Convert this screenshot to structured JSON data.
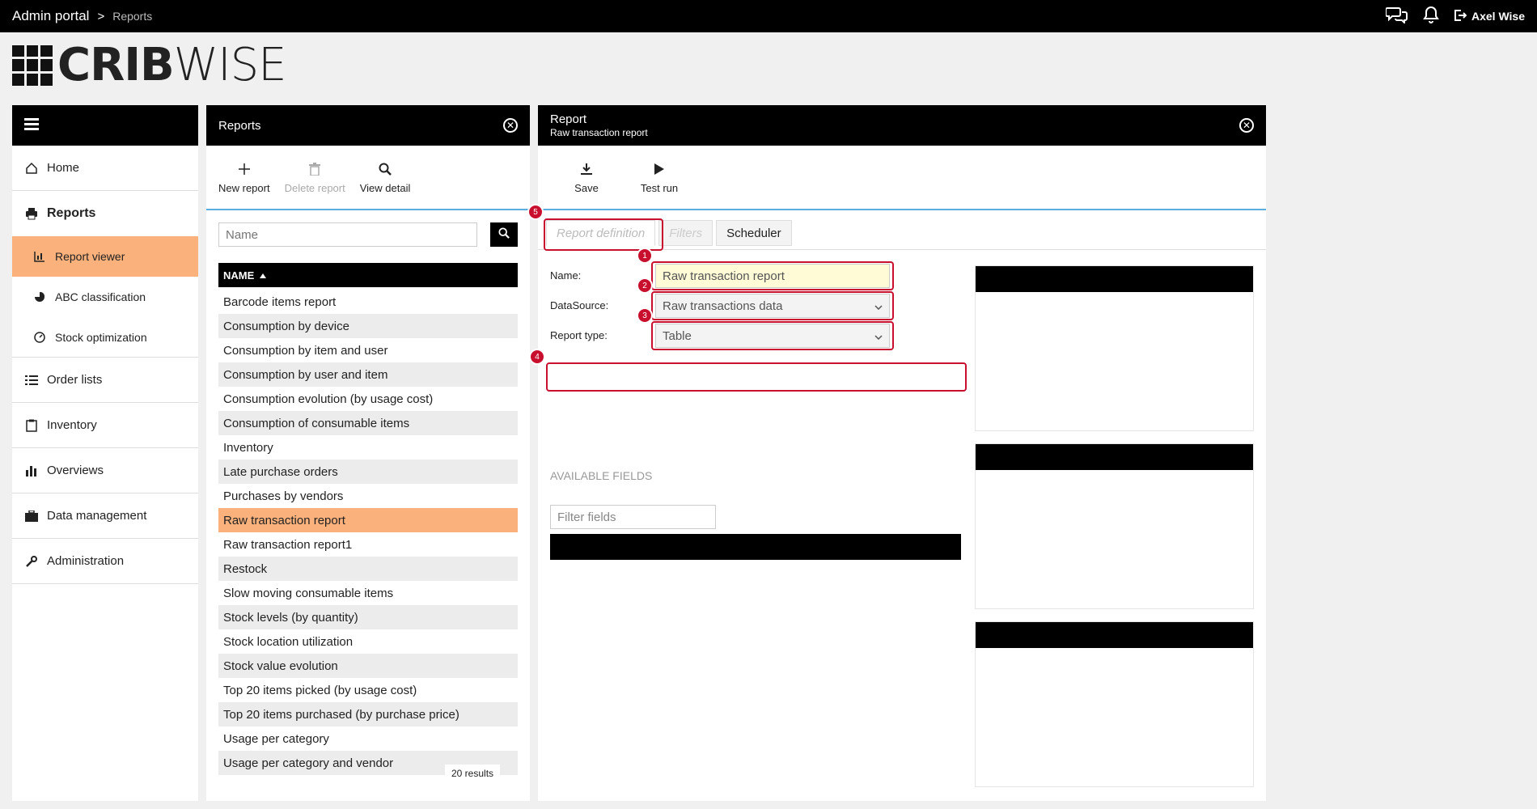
{
  "topbar": {
    "crumb_main": "Admin portal",
    "crumb_sep": ">",
    "crumb_sub": "Reports",
    "user": "Axel Wise"
  },
  "logo": {
    "brand_bold": "CRIB",
    "brand_light": "WISE"
  },
  "nav": {
    "items": [
      {
        "label": "Home",
        "icon": "home-icon"
      },
      {
        "label": "Reports",
        "icon": "printer-icon"
      },
      {
        "label": "Report viewer",
        "icon": "chart-icon"
      },
      {
        "label": "ABC classification",
        "icon": "pie-icon"
      },
      {
        "label": "Stock optimization",
        "icon": "gauge-icon"
      },
      {
        "label": "Order lists",
        "icon": "list-icon"
      },
      {
        "label": "Inventory",
        "icon": "clipboard-icon"
      },
      {
        "label": "Overviews",
        "icon": "bar-chart-icon"
      },
      {
        "label": "Data management",
        "icon": "briefcase-icon"
      },
      {
        "label": "Administration",
        "icon": "wrench-icon"
      }
    ]
  },
  "reports_panel": {
    "title": "Reports",
    "toolbar": {
      "new": "New report",
      "delete": "Delete report",
      "view": "View detail"
    },
    "search_placeholder": "Name",
    "column": "NAME",
    "rows": [
      "Barcode items report",
      "Consumption by device",
      "Consumption by item and user",
      "Consumption by user and item",
      "Consumption evolution (by usage cost)",
      "Consumption of consumable items",
      "Inventory",
      "Late purchase orders",
      "Purchases by vendors",
      "Raw transaction report",
      "Raw transaction report1",
      "Restock",
      "Slow moving consumable items",
      "Stock levels (by quantity)",
      "Stock location utilization",
      "Stock value evolution",
      "Top 20 items picked (by usage cost)",
      "Top 20 items purchased (by purchase price)",
      "Usage per category",
      "Usage per category and vendor"
    ],
    "selected_index": 9,
    "results": "20 results"
  },
  "report_panel": {
    "title": "Report",
    "subtitle": "Raw transaction report",
    "toolbar": {
      "save": "Save",
      "test_run": "Test run"
    },
    "tabs": [
      "Report definition",
      "Filters",
      "Scheduler"
    ],
    "form": {
      "name_label": "Name:",
      "name_value": "Raw transaction report",
      "datasource_label": "DataSource:",
      "datasource_value": "Raw transactions data",
      "report_type_label": "Report type:",
      "report_type_value": "Table"
    },
    "available_fields": "AVAILABLE FIELDS",
    "filter_placeholder": "Filter fields",
    "badges": [
      "1",
      "2",
      "3",
      "4",
      "5"
    ]
  },
  "colors": {
    "accent": "#fbb17b",
    "highlight": "#c8102e",
    "divider": "#5aaee0"
  }
}
